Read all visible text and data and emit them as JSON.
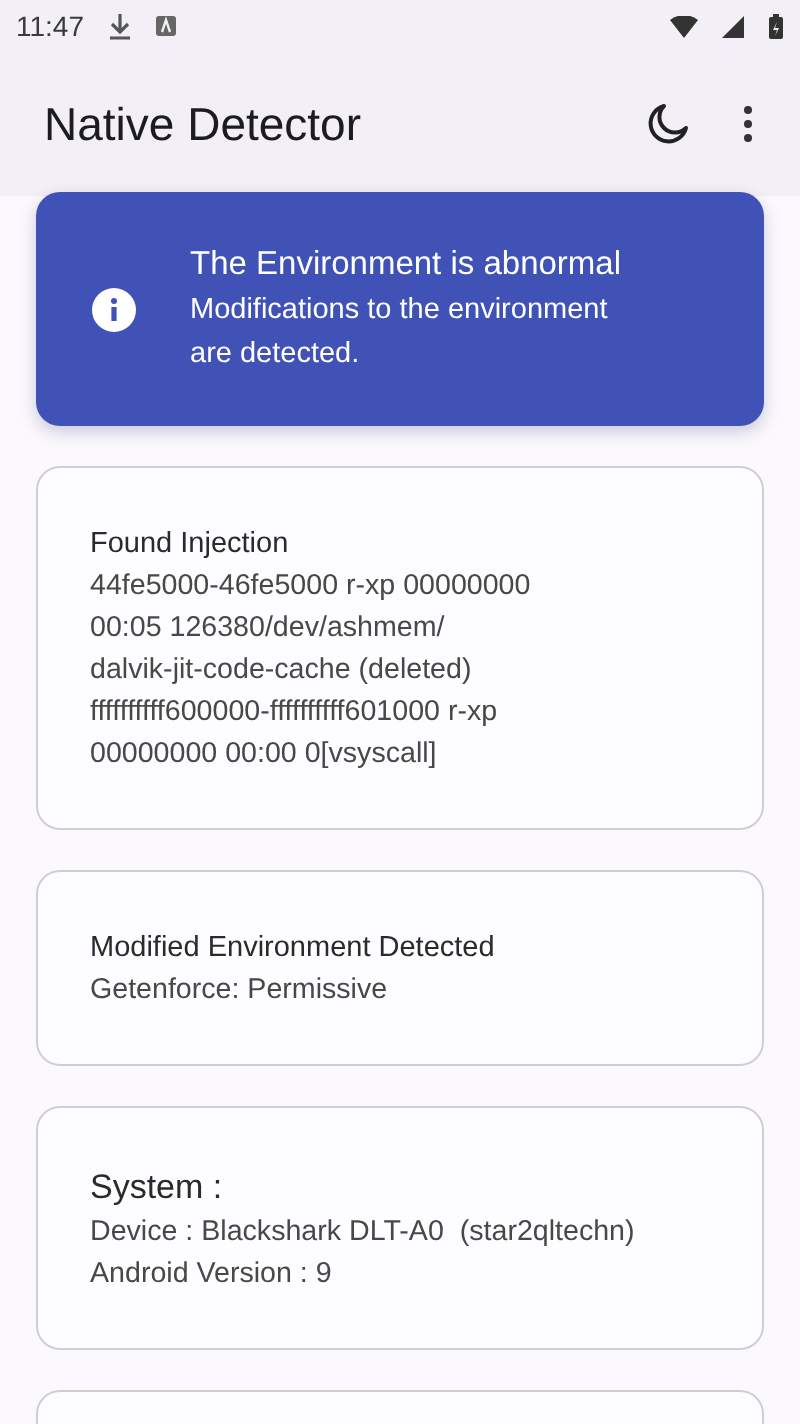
{
  "status_bar": {
    "time": "11:47"
  },
  "app_bar": {
    "title": "Native Detector"
  },
  "banner": {
    "title": "The Environment is abnormal",
    "lines": [
      "Modifications to the environment",
      "are detected."
    ]
  },
  "cards": [
    {
      "kind": "finding",
      "title": "Found Injection",
      "lines": [
        "44fe5000-46fe5000 r-xp 00000000",
        "00:05 126380/dev/ashmem/",
        "dalvik-jit-code-cache (deleted)",
        "ffffffffff600000-ffffffffff601000 r-xp",
        "00000000 00:00 0[vsyscall]"
      ]
    },
    {
      "kind": "finding",
      "title": "Modified Environment Detected",
      "lines": [
        "Getenforce: Permissive"
      ]
    },
    {
      "kind": "info",
      "title": "System :",
      "lines": [
        "Device : Blackshark DLT-A0  (star2qltechn)",
        "Android Version : 9"
      ]
    },
    {
      "kind": "empty"
    }
  ]
}
